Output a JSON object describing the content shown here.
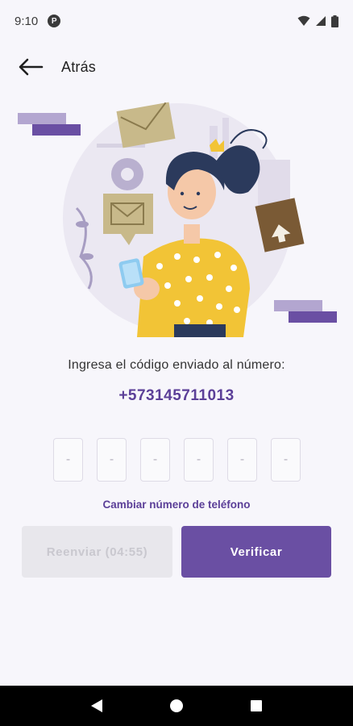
{
  "status_bar": {
    "time": "9:10",
    "app_icon_glyph": "P",
    "icons": [
      "wifi-icon",
      "signal-icon",
      "battery-icon"
    ]
  },
  "topbar": {
    "back_label": "Atrás"
  },
  "illustration": {
    "name": "woman-holding-phone-with-envelopes"
  },
  "verification": {
    "prompt": "Ingresa el código enviado al número:",
    "phone_number": "+573145711013",
    "code_digits": [
      "-",
      "-",
      "-",
      "-",
      "-",
      "-"
    ],
    "change_number_label": "Cambiar número de teléfono"
  },
  "actions": {
    "resend_label": "Reenviar (04:55)",
    "verify_label": "Verificar"
  },
  "colors": {
    "accent": "#6a4fa3",
    "accent_text": "#5b3f98",
    "disabled_bg": "#e8e7ec",
    "background": "#f7f6fb",
    "illustration_yellow": "#f2c436",
    "illustration_hair": "#2b3a5c"
  },
  "nav_bar": {
    "icons": [
      "back-triangle-icon",
      "home-circle-icon",
      "recents-square-icon"
    ]
  }
}
